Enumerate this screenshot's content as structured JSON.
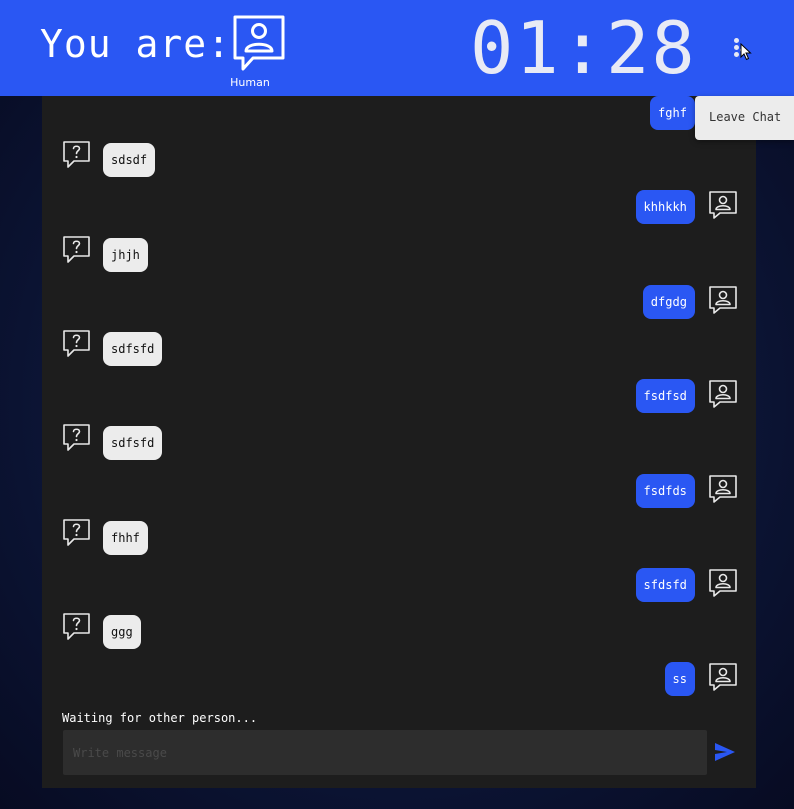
{
  "header": {
    "you_are_label": "You are:",
    "role_label": "Human",
    "timer": "01:28",
    "menu_icon": "vertical-dots-icon",
    "colors": {
      "background": "#2a57f3",
      "text": "#ffffff"
    }
  },
  "menu_popup": {
    "leave_label": "Leave Chat"
  },
  "messages": [
    {
      "sender": "mine",
      "text": "fghf"
    },
    {
      "sender": "other",
      "text": "sdsdf"
    },
    {
      "sender": "mine",
      "text": "khhkkh"
    },
    {
      "sender": "other",
      "text": "jhjh"
    },
    {
      "sender": "mine",
      "text": "dfgdg"
    },
    {
      "sender": "other",
      "text": "sdfsfd"
    },
    {
      "sender": "mine",
      "text": "fsdfsd"
    },
    {
      "sender": "other",
      "text": "sdfsfd"
    },
    {
      "sender": "mine",
      "text": "fsdfds"
    },
    {
      "sender": "other",
      "text": "fhhf"
    },
    {
      "sender": "mine",
      "text": "sfdsfd"
    },
    {
      "sender": "other",
      "text": "ggg"
    },
    {
      "sender": "mine",
      "text": "ss"
    }
  ],
  "icons": {
    "other_avatar": "question-chat-icon",
    "my_avatar": "person-chat-icon",
    "send": "send-icon"
  },
  "footer": {
    "status": "Waiting for other person...",
    "input_placeholder": "Write message"
  },
  "colors": {
    "accent": "#2a57f3",
    "panel": "#1d1d1d",
    "other_bubble": "#ececec"
  }
}
